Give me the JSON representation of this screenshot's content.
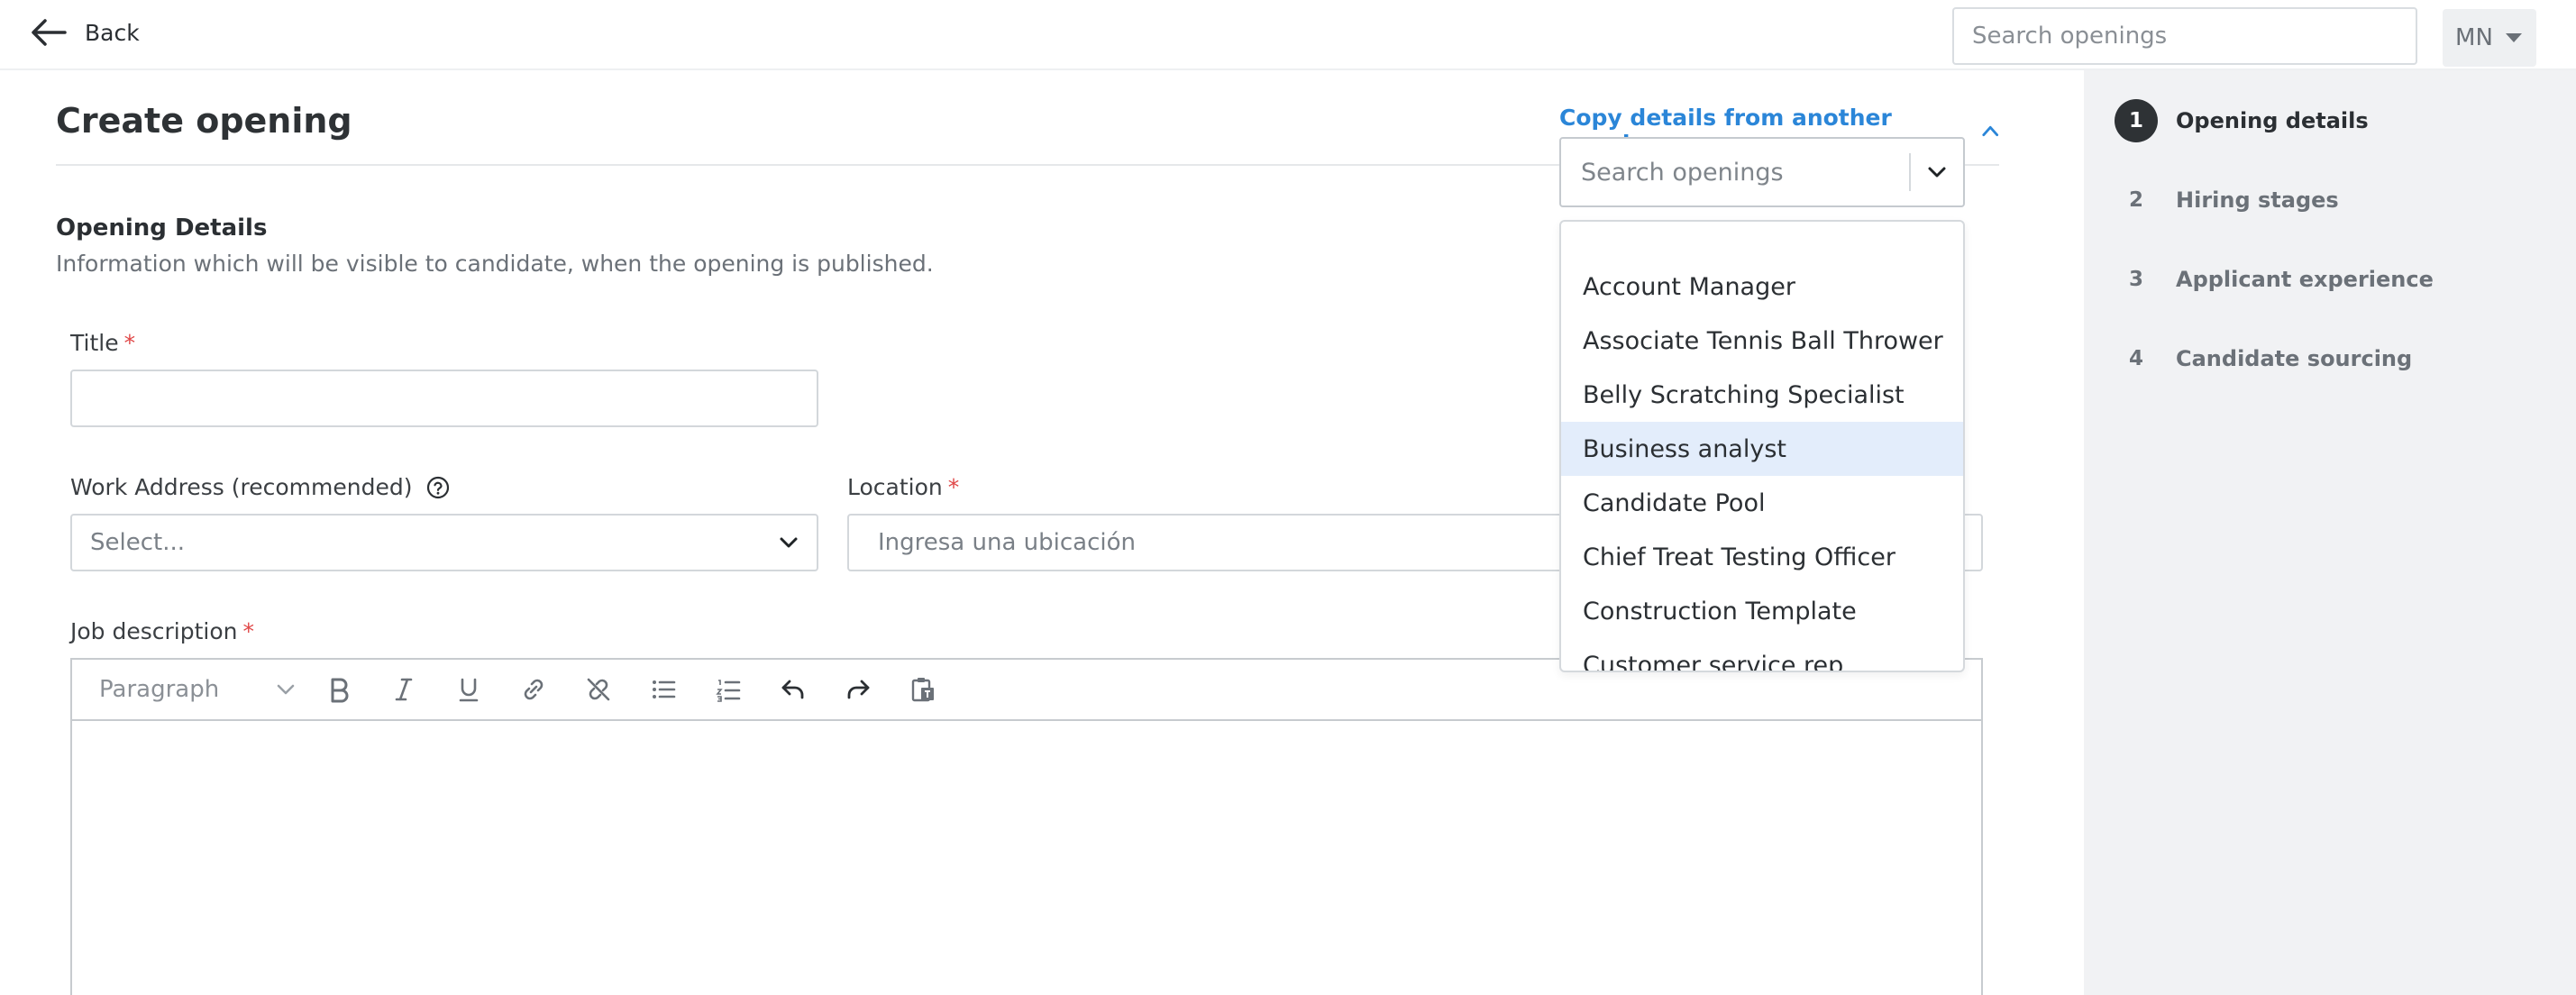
{
  "topbar": {
    "back_label": "Back",
    "search_placeholder": "Search openings",
    "user_initials": "MN"
  },
  "main": {
    "title": "Create opening",
    "copy_link": "Copy details from another opening",
    "section_title": "Opening Details",
    "section_subtitle": "Information which will be visible to candidate, when the opening is published.",
    "fields": {
      "title_label": "Title",
      "work_address_label": "Work Address (recommended)",
      "work_address_value": "Select...",
      "location_label": "Location",
      "location_placeholder": "Ingresa una ubicación",
      "job_description_label": "Job description",
      "required_mark": "*"
    },
    "editor": {
      "paragraph_label": "Paragraph",
      "tools": [
        "bold-icon",
        "italic-icon",
        "underline-icon",
        "link-icon",
        "unlink-icon",
        "bullet-list-icon",
        "numbered-list-icon",
        "undo-icon",
        "redo-icon",
        "paste-icon"
      ]
    }
  },
  "dropdown": {
    "search_placeholder": "Search openings",
    "items": [
      "Account Manager",
      "Associate Tennis Ball Thrower",
      "Belly Scratching Specialist",
      "Business analyst",
      "Candidate Pool",
      "Chief Treat Testing Officer",
      "Construction Template",
      "Customer service rep"
    ],
    "highlighted_index": 3
  },
  "sidebar": {
    "steps": [
      {
        "num": "1",
        "label": "Opening details",
        "active": true
      },
      {
        "num": "2",
        "label": "Hiring stages",
        "active": false
      },
      {
        "num": "3",
        "label": "Applicant experience",
        "active": false
      },
      {
        "num": "4",
        "label": "Candidate sourcing",
        "active": false
      }
    ]
  },
  "colors": {
    "accent": "#2b86d8",
    "required": "#e04848",
    "highlight": "#e3edfb",
    "sidebar_bg": "#f1f2f4",
    "active_step": "#2e3235"
  }
}
